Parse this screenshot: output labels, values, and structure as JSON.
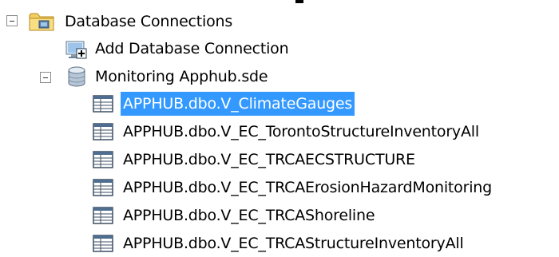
{
  "tree": {
    "root": {
      "label": "Database Connections",
      "icon": "folder-database-icon",
      "expanded": true
    },
    "add_connection": {
      "label": "Add Database Connection",
      "icon": "add-database-connection-icon"
    },
    "connection": {
      "label": "Monitoring Apphub.sde",
      "icon": "database-cylinder-icon",
      "expanded": true
    },
    "tables": [
      {
        "label": "APPHUB.dbo.V_ClimateGauges",
        "icon": "table-icon",
        "selected": true
      },
      {
        "label": "APPHUB.dbo.V_EC_TorontoStructureInventoryAll",
        "icon": "table-icon",
        "selected": false
      },
      {
        "label": "APPHUB.dbo.V_EC_TRCAECSTRUCTURE",
        "icon": "table-icon",
        "selected": false
      },
      {
        "label": "APPHUB.dbo.V_EC_TRCAErosionHazardMonitoring",
        "icon": "table-icon",
        "selected": false
      },
      {
        "label": "APPHUB.dbo.V_EC_TRCAShoreline",
        "icon": "table-icon",
        "selected": false
      },
      {
        "label": "APPHUB.dbo.V_EC_TRCAStructureInventoryAll",
        "icon": "table-icon",
        "selected": false
      }
    ]
  },
  "colors": {
    "selection_background": "#3399ff",
    "selection_text": "#ffffff"
  }
}
